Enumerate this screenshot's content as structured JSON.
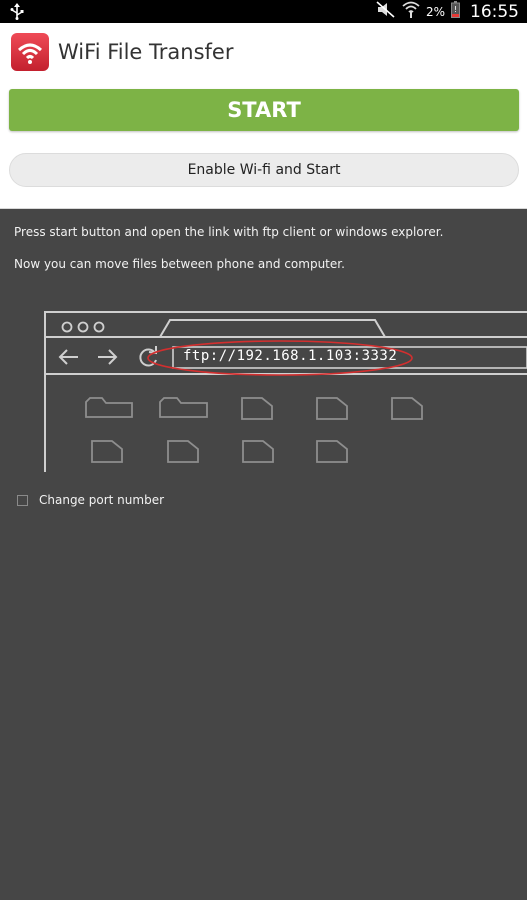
{
  "status_bar": {
    "battery_percent": "2%",
    "time": "16:55",
    "icons": [
      "usb-icon",
      "mute-icon",
      "wifi-signal-icon",
      "battery-icon"
    ]
  },
  "app": {
    "title": "WiFi File Transfer",
    "icon": "wifi-app-icon",
    "accent_color": "#7db346"
  },
  "buttons": {
    "start": "START",
    "enable_wifi": "Enable Wi-fi and Start"
  },
  "instructions": {
    "line1": "Press start button and open the link with ftp client or windows explorer.",
    "line2": "Now you can move files between phone and computer."
  },
  "illustration": {
    "url": "ftp://192.168.1.103:3332",
    "folders": 2,
    "files": 7
  },
  "options": {
    "change_port_label": "Change port number",
    "change_port_checked": false
  }
}
